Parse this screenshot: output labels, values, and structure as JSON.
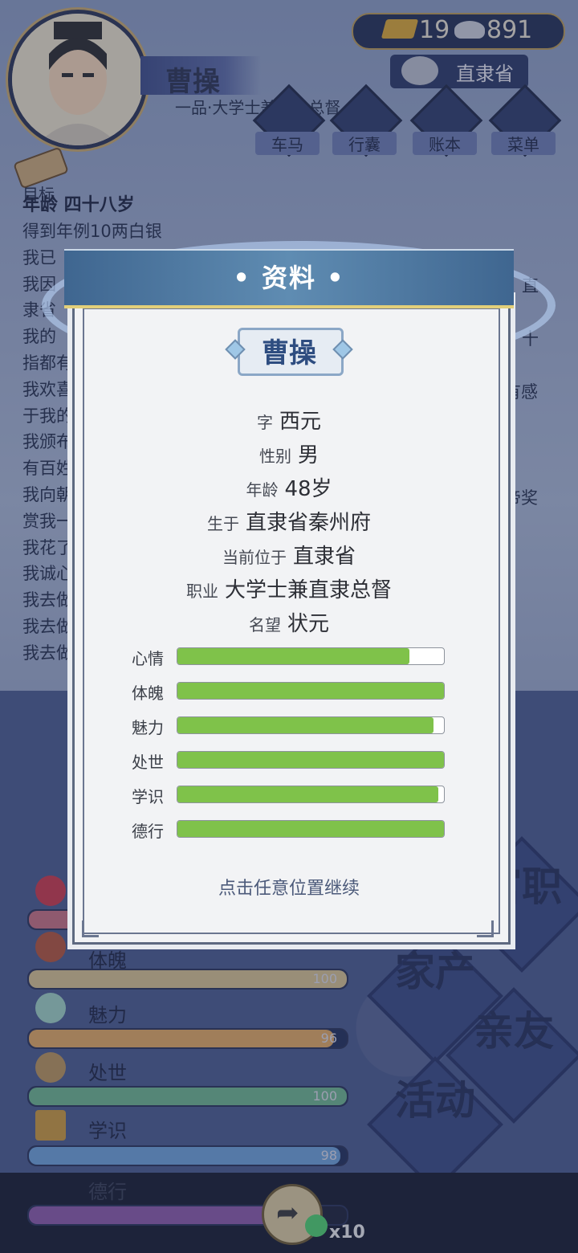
{
  "player": {
    "name": "曹操",
    "title": "一品·大学士兼直隶总督"
  },
  "currency": {
    "gold": "19",
    "silver": "891"
  },
  "location": "直隶省",
  "nav": [
    {
      "name": "nav-carriage",
      "label": "车马"
    },
    {
      "name": "nav-bag",
      "label": "行囊"
    },
    {
      "name": "nav-ledger",
      "label": "账本"
    },
    {
      "name": "nav-menu",
      "label": "菜单"
    }
  ],
  "target_label": "目标",
  "log": {
    "head": "年龄 四十八岁",
    "lines": [
      "得到年例10两白银",
      "我已",
      "我因",
      "隶省",
      "我的",
      "指都有",
      "我欢喜",
      "于我的",
      "我颁布",
      "有百姓",
      "我向朝",
      "赏我一",
      "我花了",
      "我诚心",
      "我去做",
      "我去做",
      "我去做"
    ],
    "right_fragments": [
      "直",
      "十",
      "有感",
      "帝奖"
    ]
  },
  "stats_bg": [
    {
      "name": "体魄",
      "value": "100",
      "pct": 1.0,
      "color": "#d6c08e"
    },
    {
      "name": "魅力",
      "value": "96",
      "pct": 0.96,
      "color": "#e0a860"
    },
    {
      "name": "处世",
      "value": "100",
      "pct": 1.0,
      "color": "#6db48c"
    },
    {
      "name": "学识",
      "value": "98",
      "pct": 0.98,
      "color": "#6ea0d6"
    },
    {
      "name": "德行",
      "value": "",
      "pct": 0.9,
      "color": "#8a5aa6"
    }
  ],
  "side_buttons": [
    "官职",
    "家产",
    "亲友",
    "活动"
  ],
  "share_count": "x10",
  "modal": {
    "title": "• 资料 •",
    "name": "曹操",
    "fields": [
      {
        "label": "字",
        "value": "西元"
      },
      {
        "label": "性别",
        "value": "男"
      },
      {
        "label": "年龄",
        "value": "48岁"
      },
      {
        "label": "生于",
        "value": "直隶省秦州府"
      },
      {
        "label": "当前位于",
        "value": "直隶省"
      },
      {
        "label": "职业",
        "value": "大学士兼直隶总督"
      },
      {
        "label": "名望",
        "value": "状元"
      }
    ],
    "attributes": [
      {
        "label": "心情",
        "pct": 0.87
      },
      {
        "label": "体魄",
        "pct": 1.0
      },
      {
        "label": "魅力",
        "pct": 0.96
      },
      {
        "label": "处世",
        "pct": 1.0
      },
      {
        "label": "学识",
        "pct": 0.98
      },
      {
        "label": "德行",
        "pct": 1.0
      }
    ],
    "continue": "点击任意位置继续"
  }
}
